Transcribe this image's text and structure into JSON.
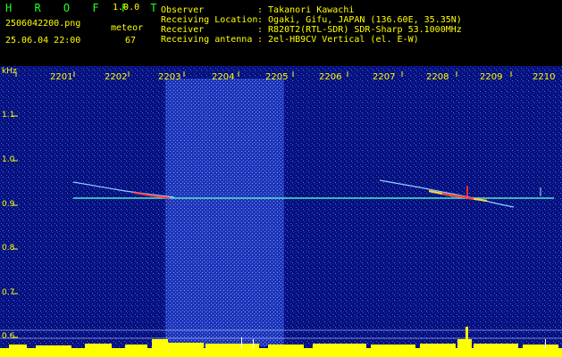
{
  "app": {
    "logo": "H R O F F T",
    "version": "1.0.0"
  },
  "file": {
    "name": "2506042200.png",
    "datetime": "25.06.04 22:00"
  },
  "meteor": {
    "label": "meteor",
    "count": "67"
  },
  "info": [
    {
      "key": "Observer",
      "value": ": Takanori Kawachi"
    },
    {
      "key": "Receiving Location",
      "value": ": Ogaki, Gifu, JAPAN (136.60E, 35.35N)"
    },
    {
      "key": "Receiver",
      "value": ": R820T2(RTL-SDR) SDR-Sharp 53.1000MHz"
    },
    {
      "key": "Receiving antenna",
      "value": ": 2el-HB9CV Vertical (el. E-W)"
    }
  ],
  "axis": {
    "unit": "kHz",
    "y_ticks": [
      "1.1",
      "1.0",
      "0.9",
      "0.8",
      "0.7",
      "0.6"
    ],
    "x_ticks": [
      "2201",
      "2202",
      "2203",
      "2204",
      "2205",
      "2206",
      "2207",
      "2208",
      "2209",
      "2210"
    ]
  },
  "colors": {
    "background": "#07107a",
    "band": "#1a2bb8",
    "carrier": "#4fe6c8",
    "label": "#ffff00",
    "spectrum": "#ffff00"
  }
}
